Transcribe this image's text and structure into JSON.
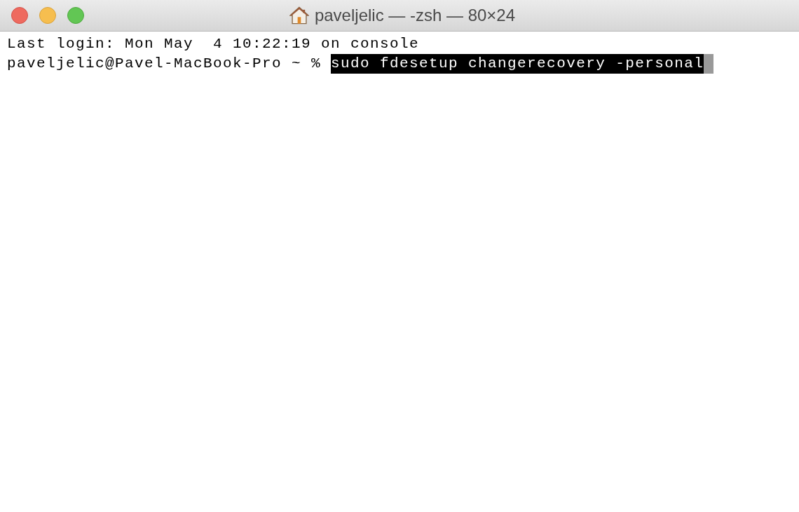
{
  "window": {
    "title": "paveljelic — -zsh — 80×24"
  },
  "terminal": {
    "lines": [
      {
        "kind": "output",
        "text": "Last login: Mon May  4 10:22:19 on console"
      },
      {
        "kind": "prompt",
        "prompt": "paveljelic@Pavel-MacBook-Pro ~ %",
        "command": "sudo fdesetup changerecovery -personal",
        "selected": true,
        "cursor": true
      }
    ]
  }
}
